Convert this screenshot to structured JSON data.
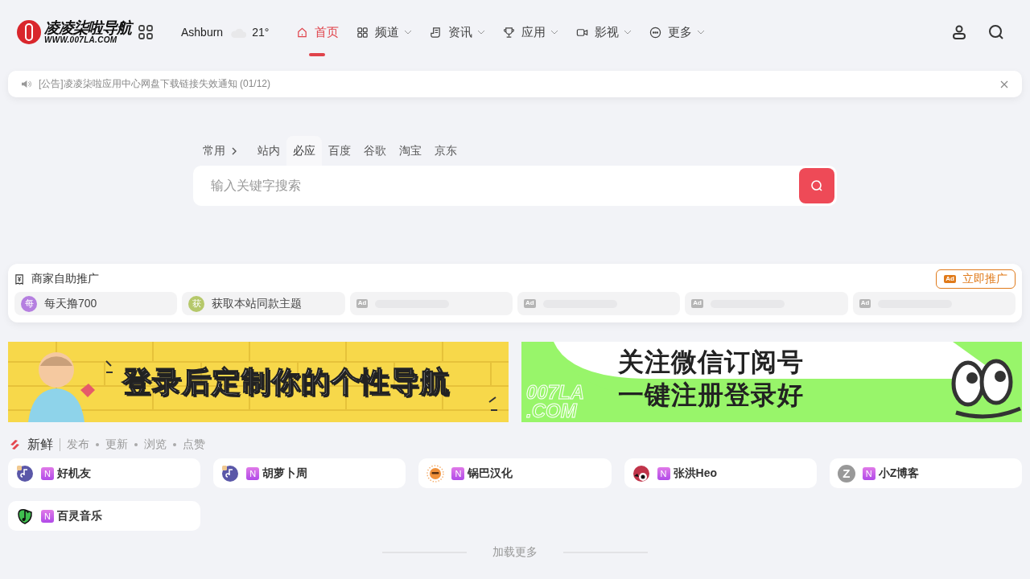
{
  "logo": {
    "title": "凌凌柒啦导航",
    "subtitle": "WWW.007LA.COM"
  },
  "weather": {
    "city": "Ashburn",
    "temperature": "21°"
  },
  "nav": [
    {
      "label": "首页",
      "selected": true,
      "dropdown": false
    },
    {
      "label": "频道",
      "selected": false,
      "dropdown": true
    },
    {
      "label": "资讯",
      "selected": false,
      "dropdown": true
    },
    {
      "label": "应用",
      "selected": false,
      "dropdown": true
    },
    {
      "label": "影视",
      "selected": false,
      "dropdown": true
    },
    {
      "label": "更多",
      "selected": false,
      "dropdown": true
    }
  ],
  "notice": {
    "text": "[公告]凌凌柒啦应用中心网盘下载链接失效通知 (01/12)"
  },
  "search": {
    "tabs": [
      {
        "label": "常用",
        "selected": false,
        "expandable": true
      },
      {
        "label": "站内",
        "selected": false,
        "expandable": false
      },
      {
        "label": "必应",
        "selected": true,
        "expandable": false
      },
      {
        "label": "百度",
        "selected": false,
        "expandable": false
      },
      {
        "label": "谷歌",
        "selected": false,
        "expandable": false
      },
      {
        "label": "淘宝",
        "selected": false,
        "expandable": false
      },
      {
        "label": "京东",
        "selected": false,
        "expandable": false
      }
    ],
    "placeholder": "输入关键字搜索"
  },
  "ads": {
    "title": "商家自助推广",
    "button": "立即推广",
    "button_badge": "Ad",
    "slots": [
      {
        "kind": "link",
        "avatar": "每",
        "color": "#b57fe0",
        "label": "每天撸700"
      },
      {
        "kind": "link",
        "avatar": "获",
        "color": "#b5c86a",
        "label": "获取本站同款主题"
      },
      {
        "kind": "empty",
        "badge": "Ad"
      },
      {
        "kind": "empty",
        "badge": "Ad"
      },
      {
        "kind": "empty",
        "badge": "Ad"
      },
      {
        "kind": "empty",
        "badge": "Ad"
      }
    ]
  },
  "banners": [
    {
      "lines": [
        "登录后定制你的个性导航"
      ],
      "color": "#f7d84a"
    },
    {
      "lines": [
        "关注微信订阅号",
        "一键注册登录好"
      ],
      "watermark": [
        "007LA",
        ".COM"
      ],
      "color": "#98f56a"
    }
  ],
  "fresh": {
    "title": "新鲜",
    "filters": [
      "发布",
      "更新",
      "浏览",
      "点赞"
    ],
    "sites": [
      {
        "badge": "N",
        "name": "好机友"
      },
      {
        "badge": "N",
        "name": "胡萝卜周"
      },
      {
        "badge": "N",
        "name": "锅巴汉化"
      },
      {
        "badge": "N",
        "name": "张洪Heo"
      },
      {
        "badge": "N",
        "name": "小Z博客",
        "avatar_text": "Z"
      },
      {
        "badge": "N",
        "name": "百灵音乐"
      }
    ],
    "load_more": "加载更多"
  }
}
